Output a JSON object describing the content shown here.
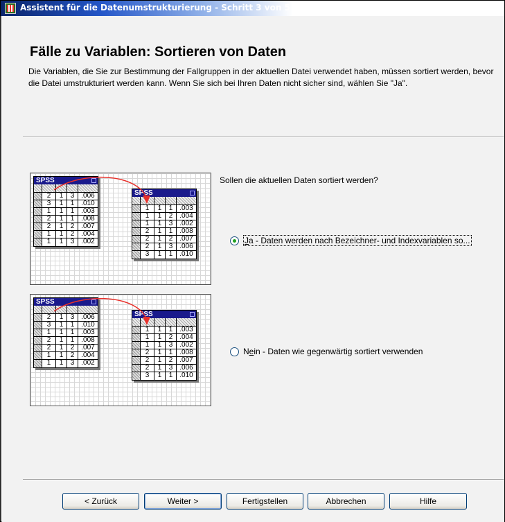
{
  "window": {
    "title": "Assistent für die Datenumstrukturierung - Schritt 3 von 5",
    "icon": "spss-wizard-icon"
  },
  "page": {
    "heading": "Fälle zu Variablen: Sortieren von Daten",
    "description": "Die Variablen, die Sie zur Bestimmung der Fallgruppen in der aktuellen Datei verwendet haben, müssen sortiert werden, bevor die Datei umstrukturiert werden kann. Wenn Sie sich bei Ihren Daten nicht sicher sind, wählen Sie \"Ja\"."
  },
  "question": "Sollen die aktuellen Daten sortiert werden?",
  "options": [
    {
      "label_prefix": "",
      "label_mnemonic": "J",
      "label_rest": "a - Daten werden nach Bezeichner- und Indexvariablen so...",
      "selected": true
    },
    {
      "label_prefix": "N",
      "label_mnemonic": "e",
      "label_rest": "in - Daten wie gegenwärtig sortiert verwenden",
      "selected": false
    }
  ],
  "illustrations": [
    {
      "left_title": "SPSS",
      "right_title": "SPSS",
      "left_rows": [
        [
          "2",
          "1",
          "3",
          ".006"
        ],
        [
          "3",
          "1",
          "1",
          ".010"
        ],
        [
          "1",
          "1",
          "1",
          ".003"
        ],
        [
          "2",
          "1",
          "1",
          ".008"
        ],
        [
          "2",
          "1",
          "2",
          ".007"
        ],
        [
          "1",
          "1",
          "2",
          ".004"
        ],
        [
          "1",
          "1",
          "3",
          ".002"
        ]
      ],
      "right_rows": [
        [
          "1",
          "1",
          "1",
          ".003"
        ],
        [
          "1",
          "1",
          "2",
          ".004"
        ],
        [
          "1",
          "1",
          "3",
          ".002"
        ],
        [
          "2",
          "1",
          "1",
          ".008"
        ],
        [
          "2",
          "1",
          "2",
          ".007"
        ],
        [
          "2",
          "1",
          "3",
          ".006"
        ],
        [
          "3",
          "1",
          "1",
          ".010"
        ]
      ]
    },
    {
      "left_title": "SPSS",
      "right_title": "SPSS",
      "left_rows": [
        [
          "2",
          "1",
          "3",
          ".006"
        ],
        [
          "3",
          "1",
          "1",
          ".010"
        ],
        [
          "1",
          "1",
          "1",
          ".003"
        ],
        [
          "2",
          "1",
          "1",
          ".008"
        ],
        [
          "2",
          "1",
          "2",
          ".007"
        ],
        [
          "1",
          "1",
          "2",
          ".004"
        ],
        [
          "1",
          "1",
          "3",
          ".002"
        ]
      ],
      "right_rows": [
        [
          "1",
          "1",
          "1",
          ".003"
        ],
        [
          "1",
          "1",
          "2",
          ".004"
        ],
        [
          "1",
          "1",
          "3",
          ".002"
        ],
        [
          "2",
          "1",
          "1",
          ".008"
        ],
        [
          "2",
          "1",
          "2",
          ".007"
        ],
        [
          "2",
          "1",
          "3",
          ".006"
        ],
        [
          "3",
          "1",
          "1",
          ".010"
        ]
      ]
    }
  ],
  "buttons": {
    "back": "< Zurück",
    "next": "Weiter >",
    "finish": "Fertigstellen",
    "cancel": "Abbrechen",
    "help": "Hilfe"
  },
  "colors": {
    "titlebar": "#0a246a",
    "dialog_bg": "#f2f2f2",
    "radio_selected": "#21a121",
    "arrow": "#e8302a"
  }
}
